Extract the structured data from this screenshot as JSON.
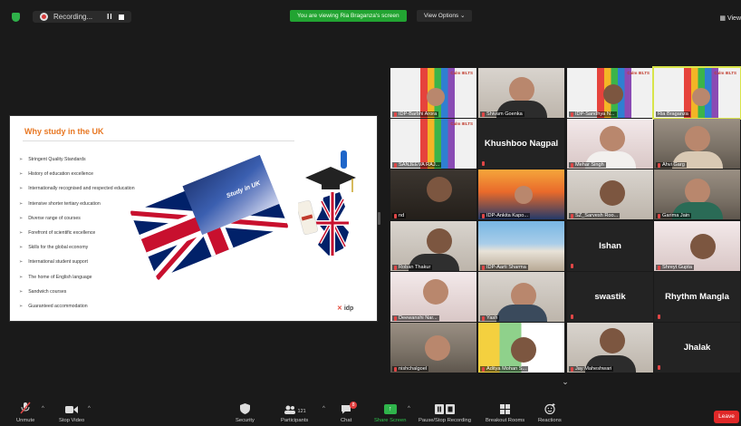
{
  "top_bar": {
    "recording_label": "Recording...",
    "pause_label": "II",
    "viewing_banner": "You are viewing Ria Braganza's screen",
    "view_options_label": "View Options ⌄",
    "view_label": "View"
  },
  "slide": {
    "title": "Why study in the UK",
    "bullets": [
      "Stringent Quality Standards",
      "History of education excellence",
      "Internationally recognised and respected education",
      "Intensive shorter tertiary education",
      "Diverse range of courses",
      "Forefront of scientific excellence",
      "Skills for the global economy",
      "International student support",
      "The home of English language",
      "Sandwich courses",
      "Guaranteed accommodation"
    ],
    "cutout_text": "Study in UK",
    "logo_x": "✕",
    "logo_text": "idp"
  },
  "gallery": {
    "tiles": [
      {
        "name": "IDP-Barbhi Arora"
      },
      {
        "name": "Shivam Goenka"
      },
      {
        "name": "IDP-Sandhya N..."
      },
      {
        "name": "Ria Braganza"
      },
      {
        "name": "SANJEEVA RAJ..."
      },
      {
        "name": "Khushboo Nagpal"
      },
      {
        "name": "Mehar Singh"
      },
      {
        "name": "Ahvi Garg"
      },
      {
        "name": "nd"
      },
      {
        "name": "IDP-Ankita Kapo..."
      },
      {
        "name": "SZ_Sarvesh Roo..."
      },
      {
        "name": "Garima Jain"
      },
      {
        "name": "Roban Thakur"
      },
      {
        "name": "IDP-Aarti Sharma"
      },
      {
        "name": "Ishan"
      },
      {
        "name": "Shreyt Gupta"
      },
      {
        "name": "Deewanshi Nar..."
      },
      {
        "name": "Yash"
      },
      {
        "name": "swastik"
      },
      {
        "name": "Rhythm Mangla"
      },
      {
        "name": "nishchalgoel"
      },
      {
        "name": "Aditya Mohan S..."
      },
      {
        "name": "Jay Maheshwari"
      },
      {
        "name": "Jhalak"
      }
    ],
    "studio_logo": "Calm IELTS",
    "scroll_down": "⌄"
  },
  "toolbar": {
    "unmute": "Unmute",
    "stop_video": "Stop Video",
    "security": "Security",
    "participants": "Participants",
    "participants_count": "121",
    "chat": "Chat",
    "chat_badge": "8",
    "share_screen": "Share Screen",
    "pause_stop_recording": "Pause/Stop Recording",
    "breakout_rooms": "Breakout Rooms",
    "reactions": "Reactions",
    "leave": "Leave"
  },
  "colors": {
    "accent_green": "#22a432",
    "leave_red": "#e02828",
    "slide_title_orange": "#e87722",
    "active_speaker": "#d8e44a"
  }
}
